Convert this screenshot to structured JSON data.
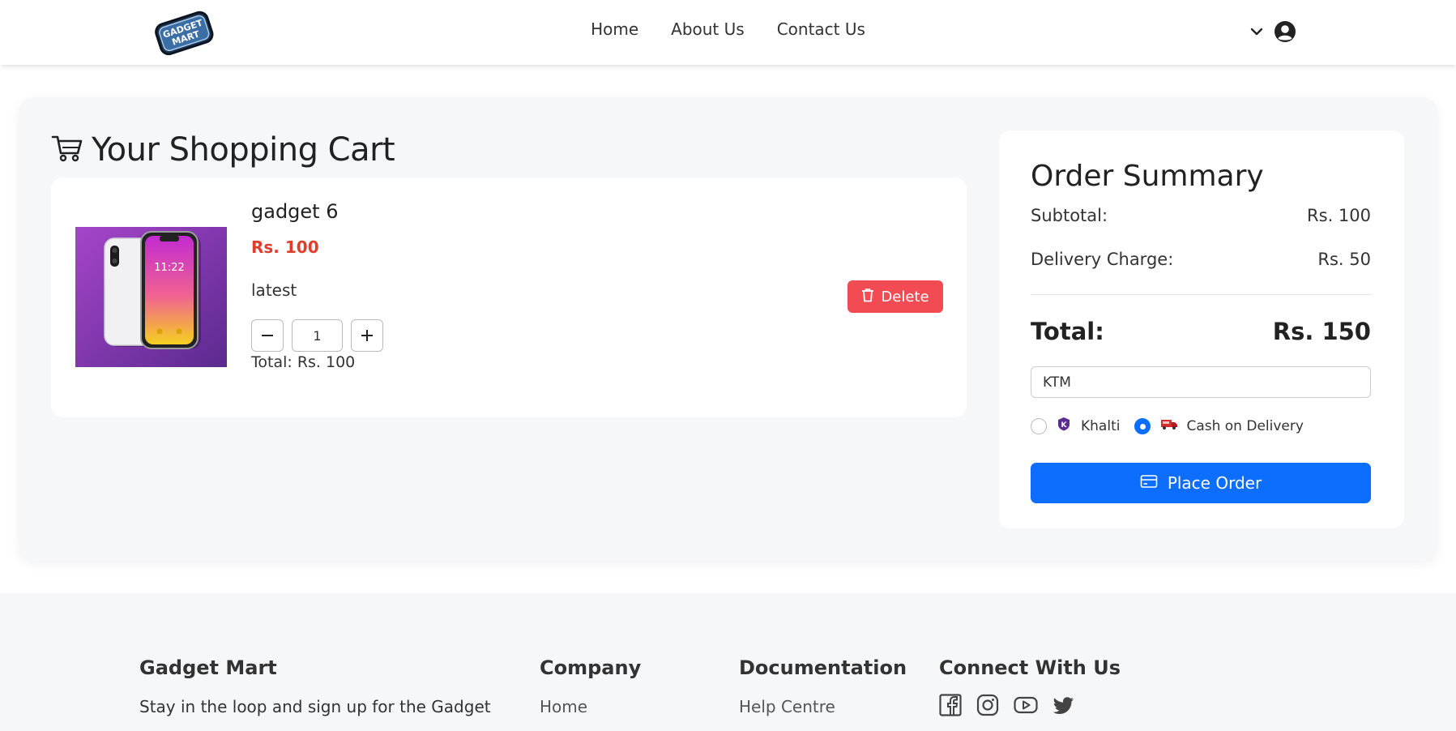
{
  "navbar": {
    "logo_text": "GADGET MART",
    "links": [
      "Home",
      "About Us",
      "Contact Us"
    ],
    "icons": [
      "chevron-down-icon",
      "user-circle-icon"
    ]
  },
  "cart": {
    "title": "Your Shopping Cart",
    "item": {
      "name": "gadget 6",
      "price": "Rs. 100",
      "description": "latest",
      "quantity": "1",
      "total": "Total: Rs. 100",
      "delete_label": "Delete",
      "image_time": "11:22"
    }
  },
  "summary": {
    "title": "Order Summary",
    "subtotal_label": "Subtotal:",
    "subtotal_value": "Rs. 100",
    "delivery_label": "Delivery Charge:",
    "delivery_value": "Rs. 50",
    "total_label": "Total:",
    "total_value": "Rs. 150",
    "address_value": "KTM",
    "payment_options": [
      {
        "label": "Khalti",
        "selected": false
      },
      {
        "label": "Cash on Delivery",
        "selected": true
      }
    ],
    "place_order_label": "Place Order"
  },
  "footer": {
    "brand": {
      "title": "Gadget Mart",
      "text": "Stay in the loop and sign up for the Gadget"
    },
    "company": {
      "title": "Company",
      "first_link": "Home"
    },
    "documentation": {
      "title": "Documentation",
      "first_link": "Help Centre"
    },
    "connect": {
      "title": "Connect With Us",
      "icons": [
        "facebook-icon",
        "instagram-icon",
        "youtube-icon",
        "twitter-icon"
      ]
    }
  },
  "colors": {
    "accent": "#0d6efd",
    "danger": "#f24b53",
    "price": "#e03e2d",
    "background": "#f6f7f9"
  }
}
